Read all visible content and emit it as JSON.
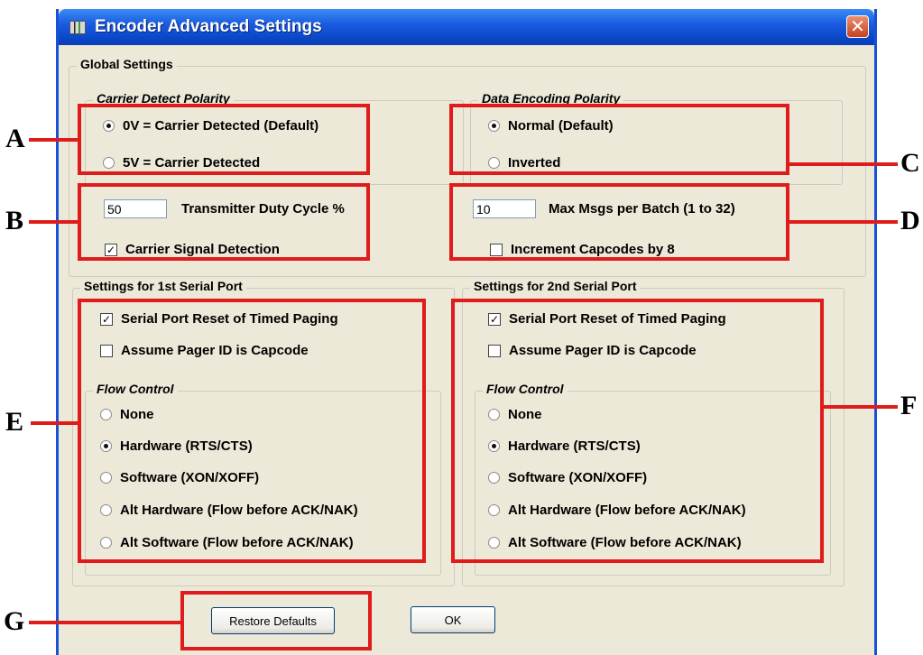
{
  "window": {
    "title": "Encoder Advanced Settings",
    "close_glyph": "✕"
  },
  "global": {
    "legend": "Global Settings",
    "carrier_polarity": {
      "legend": "Carrier Detect Polarity",
      "options": [
        "0V = Carrier Detected (Default)",
        "5V = Carrier Detected"
      ],
      "selected": 0
    },
    "data_polarity": {
      "legend": "Data Encoding Polarity",
      "options": [
        "Normal (Default)",
        "Inverted"
      ],
      "selected": 0
    },
    "duty_cycle": {
      "value": "50",
      "label": "Transmitter Duty Cycle %"
    },
    "carrier_signal_detection": {
      "label": "Carrier Signal Detection",
      "checked": true
    },
    "max_msgs": {
      "value": "10",
      "label": "Max Msgs per Batch (1 to 32)"
    },
    "increment_capcodes": {
      "label": "Increment Capcodes by 8",
      "checked": false
    }
  },
  "port1": {
    "legend": "Settings for 1st Serial Port",
    "reset_timed_paging": {
      "label": "Serial Port Reset of Timed Paging",
      "checked": true
    },
    "assume_pager_id": {
      "label": "Assume Pager ID is Capcode",
      "checked": false
    },
    "flow_control": {
      "legend": "Flow Control",
      "options": [
        "None",
        "Hardware (RTS/CTS)",
        "Software (XON/XOFF)",
        "Alt Hardware (Flow before ACK/NAK)",
        "Alt Software (Flow before ACK/NAK)"
      ],
      "selected": 1
    }
  },
  "port2": {
    "legend": "Settings for 2nd Serial Port",
    "reset_timed_paging": {
      "label": "Serial Port Reset of Timed Paging",
      "checked": true
    },
    "assume_pager_id": {
      "label": "Assume Pager ID is Capcode",
      "checked": false
    },
    "flow_control": {
      "legend": "Flow Control",
      "options": [
        "None",
        "Hardware (RTS/CTS)",
        "Software (XON/XOFF)",
        "Alt Hardware (Flow before ACK/NAK)",
        "Alt Software (Flow before ACK/NAK)"
      ],
      "selected": 1
    }
  },
  "buttons": {
    "restore": "Restore Defaults",
    "ok": "OK"
  },
  "callouts": {
    "A": "A",
    "B": "B",
    "C": "C",
    "D": "D",
    "E": "E",
    "F": "F",
    "G": "G"
  },
  "colors": {
    "annotation": "#e01b1b",
    "titlebar": "#0a47c9",
    "dialog_bg": "#ece9d8"
  }
}
